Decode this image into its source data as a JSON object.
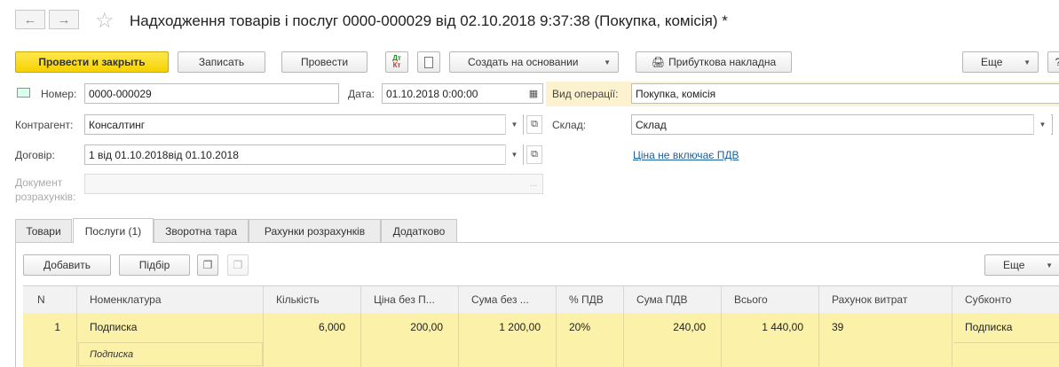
{
  "window": {
    "title": "Надходження товарів і послуг 0000-000029 від 02.10.2018 9:37:38 (Покупка, комісія) *"
  },
  "toolbar": {
    "post_close": "Провести и закрыть",
    "write": "Записать",
    "post": "Провести",
    "create_based": "Создать на основании",
    "print_receipt": "Прибуткова накладна",
    "more": "Еще",
    "help": "?"
  },
  "form": {
    "number_label": "Номер:",
    "number_value": "0000-000029",
    "date_label": "Дата:",
    "date_value": "01.10.2018  0:00:00",
    "operation_label": "Вид операції:",
    "operation_value": "Покупка, комісія",
    "counterparty_label": "Контрагент:",
    "counterparty_value": "Консалтинг",
    "warehouse_label": "Склад:",
    "warehouse_value": "Склад",
    "contract_label": "Договір:",
    "contract_value": "1 від 01.10.2018від 01.10.2018",
    "vat_link": "Ціна не включає ПДВ",
    "settlement_doc_label_1": "Документ",
    "settlement_doc_label_2": "розрахунків:",
    "settlement_doc_value": ""
  },
  "tabs": [
    {
      "label": "Товари"
    },
    {
      "label": "Послуги (1)"
    },
    {
      "label": "Зворотна тара"
    },
    {
      "label": "Рахунки розрахунків"
    },
    {
      "label": "Додатково"
    }
  ],
  "table_toolbar": {
    "add": "Добавить",
    "select": "Підбір",
    "more": "Еще"
  },
  "table": {
    "columns": [
      "N",
      "Номенклатура",
      "Кількість",
      "Ціна без П...",
      "Сума без ...",
      "% ПДВ",
      "Сума ПДВ",
      "Всього",
      "Рахунок витрат",
      "Субконто"
    ],
    "rows": [
      {
        "n": "1",
        "item": "Подписка",
        "item_content": "Подписка",
        "qty": "6,000",
        "price": "200,00",
        "sum": "1 200,00",
        "vat_rate": "20%",
        "vat_sum": "240,00",
        "total": "1 440,00",
        "account": "39",
        "subconto": "Подписка"
      }
    ]
  },
  "colors": {
    "primary_button": "#f5d100",
    "selected_row": "#fbf1a8",
    "link": "#1a5f9e",
    "operation_highlight": "#fdf2cf"
  }
}
